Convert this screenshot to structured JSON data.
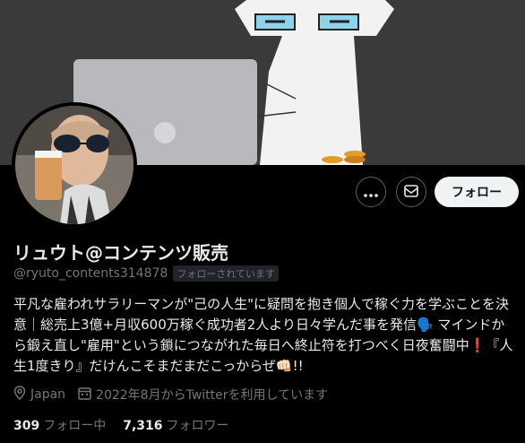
{
  "profile": {
    "display_name": "リュウト@コンテンツ販売",
    "handle": "@ryuto_contents314878",
    "follows_you": "フォローされています",
    "bio": "平凡な雇われサラリーマンが\"己の人生\"に疑問を抱き個人で稼ぐ力を学ぶことを決意｜総売上3億+月収600万稼ぐ成功者2人より日々学んだ事を発信🗣️ マインドから鍛え直し\"雇用\"という鎖につながれた毎日へ終止符を打つべく日夜奮闘中❗️『人生1度きり』だけんこそまだまだこっからぜ👊🏻!!",
    "location": "Japan",
    "joined": "2022年8月からTwitterを利用しています",
    "following_count": "309",
    "following_label": "フォロー中",
    "followers_count": "7,316",
    "followers_label": "フォロワー"
  },
  "actions": {
    "follow_label": "フォロー",
    "more_icon": "more-icon",
    "message_icon": "mail-icon"
  },
  "colors": {
    "background": "#000000",
    "text_primary": "#e7e9ea",
    "text_secondary": "#71767b",
    "follow_button_bg": "#eff3f4",
    "border": "#536471"
  }
}
